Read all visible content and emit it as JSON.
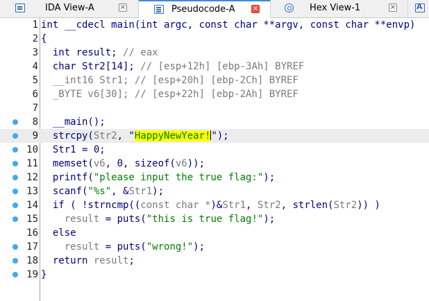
{
  "tabs": [
    {
      "label": "IDA View-A",
      "icon": "list-icon",
      "active": false
    },
    {
      "label": "Pseudocode-A",
      "icon": "document-icon",
      "active": true
    },
    {
      "label": "Hex View-1",
      "icon": "hex-icon",
      "active": false
    },
    {
      "label": "",
      "icon": "structures-icon",
      "active": false
    }
  ],
  "close_glyph": "×",
  "line_numbers": [
    "1",
    "2",
    "3",
    "4",
    "5",
    "6",
    "7",
    "8",
    "9",
    "10",
    "11",
    "12",
    "13",
    "14",
    "15",
    "16",
    "17",
    "18",
    "19"
  ],
  "code": {
    "l1": "int __cdecl main(int argc, const char **argv, const char **envp)",
    "l2": "{",
    "l3a": "  int result; ",
    "l3b": "// eax",
    "l4a": "  char Str2[14]; ",
    "l4b": "// [esp+12h] [ebp-3Ah] BYREF",
    "l5a": "  __int16 Str1; ",
    "l5b": "// [esp+20h] [ebp-2Ch] BYREF",
    "l6a": "  _BYTE v6[30]; ",
    "l6b": "// [esp+22h] [ebp-2Ah] BYREF",
    "l7": "",
    "l8": "  __main();",
    "l9a": "  strcpy(",
    "l9b": "Str2",
    "l9c": ", \"",
    "l9d": "HappyNewYear!",
    "l9e": "\");",
    "l10": "  Str1 = 0;",
    "l11a": "  memset(",
    "l11b": "v6",
    "l11c": ", 0, sizeof(",
    "l11d": "v6",
    "l11e": "));",
    "l12a": "  printf(",
    "l12b": "\"please input the true flag:\"",
    "l12c": ");",
    "l13a": "  scanf(",
    "l13b": "\"%s\"",
    "l13c": ", &",
    "l13d": "Str1",
    "l13e": ");",
    "l14a": "  if ( !strncmp((",
    "l14b": "const char *",
    "l14c": ")&",
    "l14d": "Str1",
    "l14e": ", ",
    "l14f": "Str2",
    "l14g": ", strlen(",
    "l14h": "Str2",
    "l14i": ")) )",
    "l15a": "    ",
    "l15b": "result",
    "l15c": " = puts(",
    "l15d": "\"this is true flag!\"",
    "l15e": ");",
    "l16": "  else",
    "l17a": "    ",
    "l17b": "result",
    "l17c": " = puts(",
    "l17d": "\"wrong!\"",
    "l17e": ");",
    "l18a": "  return ",
    "l18b": "result",
    "l18c": ";",
    "l19": "}"
  },
  "colors": {
    "keyword": "#000080",
    "comment": "#7a7a7a",
    "string": "#008000",
    "highlight": "#ffff00",
    "breakpoint": "#3fa9f5",
    "active_tab_accent": "#3c8ad8"
  }
}
